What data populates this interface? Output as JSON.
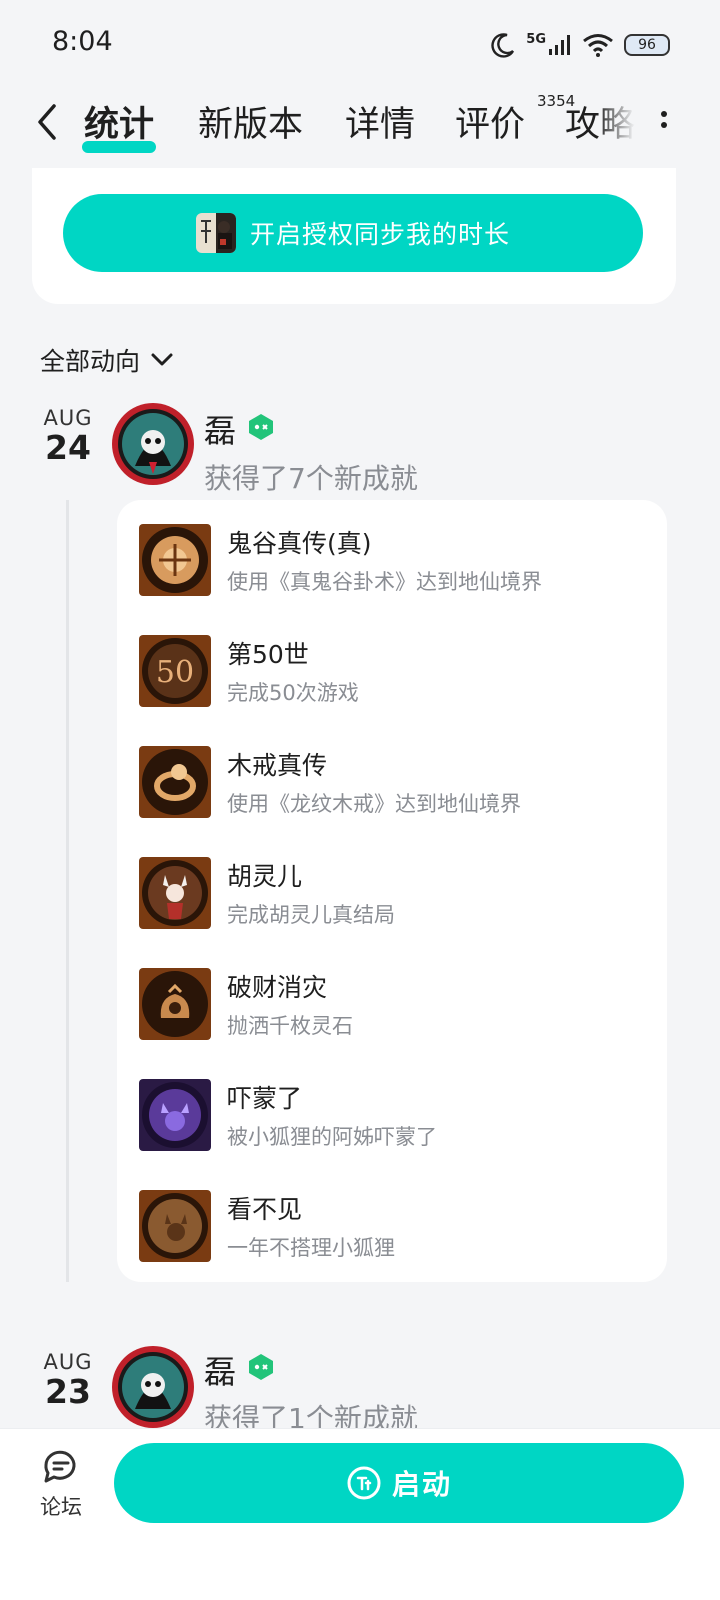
{
  "status": {
    "time": "8:04",
    "network": "5G",
    "battery": "96"
  },
  "nav": {
    "tabs": [
      {
        "label": "统计"
      },
      {
        "label": "新版本"
      },
      {
        "label": "详情"
      },
      {
        "label": "评价"
      },
      {
        "label": "攻略"
      }
    ],
    "review_count": "3354"
  },
  "auth": {
    "button_label": "开启授权同步我的时长"
  },
  "filter": {
    "label": "全部动向"
  },
  "feed": [
    {
      "month": "AUG",
      "day": "24",
      "user": "磊",
      "event": "获得了7个新成就",
      "achievements": [
        {
          "title": "鬼谷真传(真)",
          "desc": "使用《真鬼谷卦术》达到地仙境界"
        },
        {
          "title": "第50世",
          "desc": "完成50次游戏"
        },
        {
          "title": "木戒真传",
          "desc": "使用《龙纹木戒》达到地仙境界"
        },
        {
          "title": "胡灵儿",
          "desc": "完成胡灵儿真结局"
        },
        {
          "title": "破财消灾",
          "desc": "抛洒千枚灵石"
        },
        {
          "title": "吓蒙了",
          "desc": "被小狐狸的阿姊吓蒙了"
        },
        {
          "title": "看不见",
          "desc": "一年不搭理小狐狸"
        }
      ]
    },
    {
      "month": "AUG",
      "day": "23",
      "user": "磊",
      "event": "获得了1个新成就"
    }
  ],
  "bottom": {
    "forum_label": "论坛",
    "launch_label": "启动"
  },
  "colors": {
    "accent": "#00d6c4",
    "muted_text": "#8a8d93"
  }
}
